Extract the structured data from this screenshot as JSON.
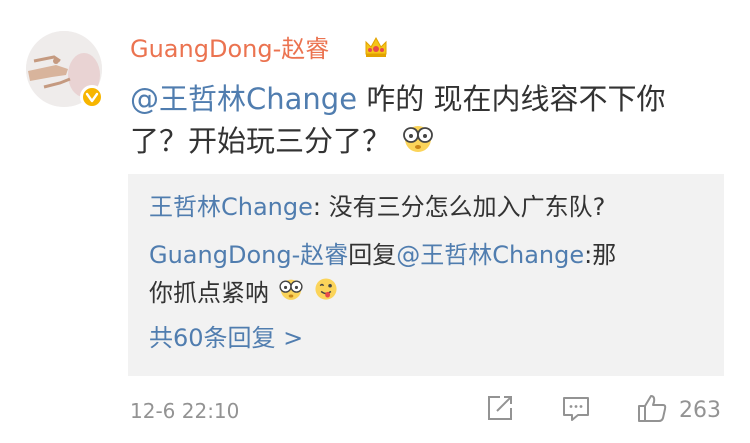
{
  "comment": {
    "username": "GuangDong-赵睿",
    "mention": "@王哲林Change",
    "text_line1": " 咋的 现在内线容不下你",
    "text_line2": "了？开始玩三分了？",
    "emoji_end": "glasses-face-icon"
  },
  "replies": {
    "reply1_author": "王哲林Change",
    "reply1_text": ": 没有三分怎么加入广东队?",
    "reply2_author": "GuangDong-赵睿",
    "reply2_action": "回复",
    "reply2_mention": "@王哲林Change",
    "reply2_text_a": ":那",
    "reply2_text_b": "你抓点紧呐",
    "more_label": "共60条回复 >"
  },
  "footer": {
    "time": "12-6 22:10",
    "like_count": "263"
  },
  "colors": {
    "username": "#eb7350",
    "link": "#507daf",
    "meta": "#939393",
    "reply_bg": "#f2f2f2"
  }
}
